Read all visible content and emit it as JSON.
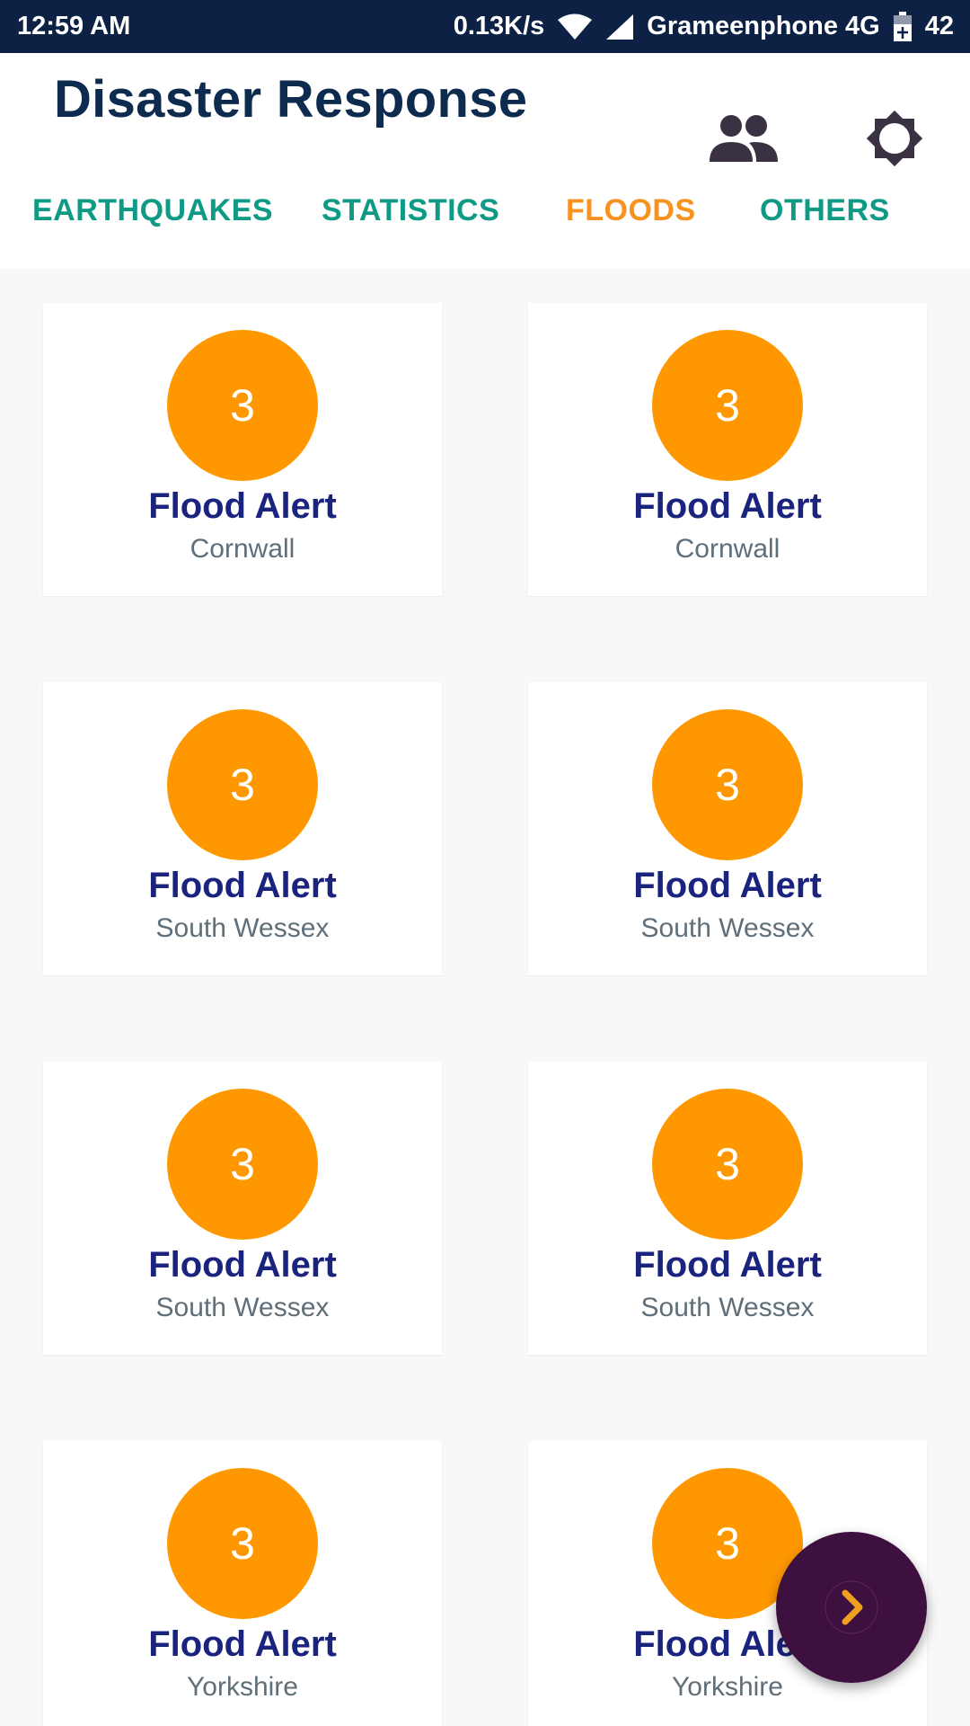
{
  "status_bar": {
    "time": "12:59 AM",
    "network_speed": "0.13K/s",
    "carrier": "Grameenphone 4G",
    "battery": "42",
    "icons": [
      "wifi-icon",
      "signal-icon",
      "battery-icon"
    ]
  },
  "header": {
    "title": "Disaster Response",
    "actions": [
      "people-icon",
      "gear-icon"
    ]
  },
  "tabs": [
    {
      "label": "EARTHQUAKES",
      "active": false
    },
    {
      "label": "STATISTICS",
      "active": false
    },
    {
      "label": "FLOODS",
      "active": true
    },
    {
      "label": "OTHERS",
      "active": false
    }
  ],
  "cards": [
    {
      "level": "3",
      "title": "Flood Alert",
      "region": "Cornwall"
    },
    {
      "level": "3",
      "title": "Flood Alert",
      "region": "Cornwall"
    },
    {
      "level": "3",
      "title": "Flood Alert",
      "region": "South Wessex"
    },
    {
      "level": "3",
      "title": "Flood Alert",
      "region": "South Wessex"
    },
    {
      "level": "3",
      "title": "Flood Alert",
      "region": "South Wessex"
    },
    {
      "level": "3",
      "title": "Flood Alert",
      "region": "South Wessex"
    },
    {
      "level": "3",
      "title": "Flood Alert",
      "region": "Yorkshire"
    },
    {
      "level": "3",
      "title": "Flood Alert",
      "region": "Yorkshire"
    }
  ],
  "fab": {
    "icon": "chevron-right-icon"
  },
  "colors": {
    "status_bar": "#0d2145",
    "title": "#0d2b4e",
    "tab": "#0f9a86",
    "tab_active": "#f7931e",
    "alert_circle": "#ff9800",
    "card_title": "#1a237e",
    "fab": "#3d1040",
    "fab_icon": "#f0a020"
  }
}
